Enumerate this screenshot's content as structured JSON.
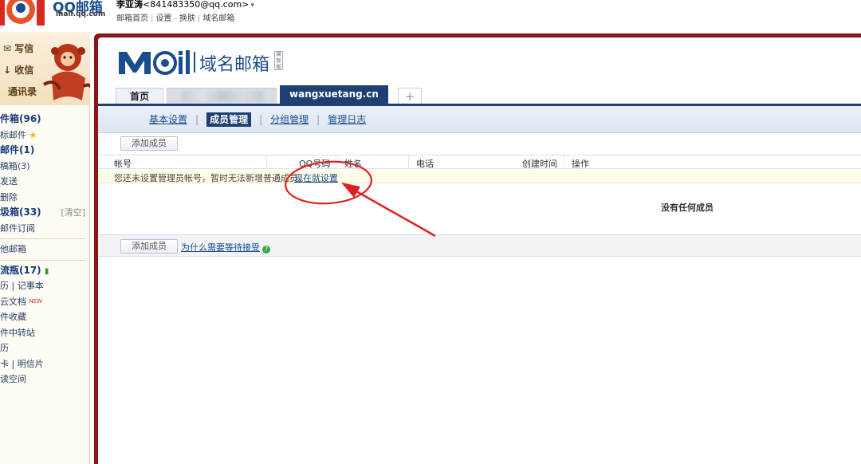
{
  "header": {
    "logo_text": "QQ邮箱",
    "logo_sub": "mail.qq.com",
    "user_name": "李亚涛",
    "user_email": "<841483350@qq.com>",
    "user_caret": "▾",
    "links": [
      "邮箱首页",
      "设置",
      "换肤",
      "域名邮箱"
    ],
    "link_separator": "|",
    "link_dash": "-"
  },
  "sidebar": {
    "actions": [
      "写信",
      "收信",
      "通讯录"
    ],
    "items": [
      {
        "label": "件箱(96)",
        "bold": true
      },
      {
        "label": "标邮件",
        "icon": "star"
      },
      {
        "label": "邮件(1)",
        "bold": true
      },
      {
        "label": "稿箱(3)"
      },
      {
        "label": "发送"
      },
      {
        "label": "删除"
      },
      {
        "label": "圾箱(33)",
        "bold": true,
        "extra": "[清空]"
      },
      {
        "label": "邮件订阅"
      },
      {
        "label": "他邮箱"
      },
      {
        "label": "流瓶(17)",
        "bold": true,
        "icon": "bottle"
      },
      {
        "label": "历 | 记事本"
      },
      {
        "label": "云文档",
        "sup": "NEW"
      },
      {
        "label": "件收藏"
      },
      {
        "label": "件中转站"
      },
      {
        "label": "历"
      },
      {
        "label": "卡 | 明信片"
      },
      {
        "label": "读空间"
      }
    ]
  },
  "main": {
    "brand_word": "Mail",
    "brand_title": "域名邮箱",
    "brand_badge": "国际版",
    "tabs": {
      "home": "首页",
      "active": "wangxuetang.cn",
      "plus": "+"
    },
    "subnav": {
      "items": [
        "基本设置",
        "成员管理",
        "分组管理",
        "管理日志"
      ],
      "active_index": 1,
      "separator": "|"
    },
    "toolbar": {
      "add_member": "添加成员",
      "why_link": "为什么需要等待接受",
      "help_icon": "?"
    },
    "table": {
      "columns": [
        "帐号",
        "QQ号码",
        "姓名",
        "电话",
        "创建时间",
        "操作"
      ]
    },
    "notice": {
      "text": "您还未设置管理员帐号，暂时无法新增普通成员。",
      "link": "现在就设置"
    },
    "empty_text": "没有任何成员"
  },
  "colors": {
    "frame": "#8b1414",
    "brand_blue": "#1a4d8f",
    "active_tab": "#1d3f73",
    "annotation": "#e02020"
  }
}
